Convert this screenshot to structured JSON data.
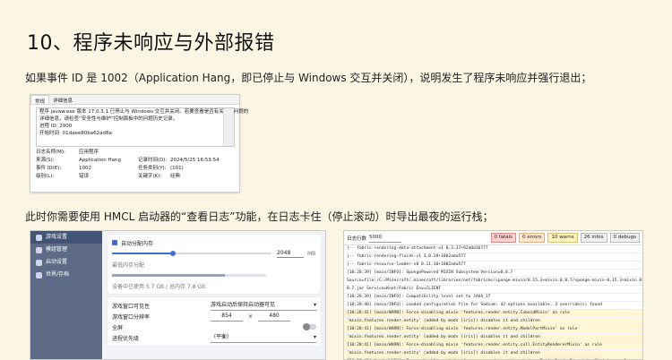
{
  "heading": "10、程序未响应与外部报错",
  "para1": "如果事件 ID 是 1002（Application Hang，即已停止与 Windows 交互并关闭），说明发生了程序未响应并强行退出；",
  "para2": "此时你需要使用 HMCL 启动器的“查看日志”功能，在日志卡住（停止滚动）时导出最夜的运行栈；",
  "event_viewer": {
    "tabs": [
      "常规",
      "详细信息"
    ],
    "description_lines": [
      "程序 javaw.exe 版本 17.0.3.1 已停止与 Windows 交互并关闭。若要查看是否有关于该问题的",
      "详细信息，请检查“安全性与维护”控制面板中的问题历史记录。",
      "进程 ID: 2900",
      "开始时间: 01daee80ba62ad8a"
    ],
    "rows": [
      [
        "日志名称(M):",
        "应用程序",
        "",
        ""
      ],
      [
        "来源(S):",
        "Application Hang",
        "记录时间(D):",
        "2024/5/25 16:53:54"
      ],
      [
        "事件 ID(E):",
        "1002",
        "任务类别(Y):",
        "(101)"
      ],
      [
        "级别(L):",
        "错误",
        "关键字(K):",
        "经典"
      ]
    ]
  },
  "hmcl": {
    "nav": [
      "游戏设置",
      "模组管理",
      "启动设置",
      "世界/存档"
    ],
    "auto_memory_label": "自动分配内存",
    "memory_usage_label": "最低内存分配",
    "memory_value": "2048",
    "memory_unit": "MB",
    "memory_fraction": 0.38,
    "usage_text": "设备中已使用 5.7 GB / 总内存 7.8 GB",
    "usage_fraction": 0.73,
    "rows": [
      {
        "label": "游戏窗口可见性",
        "value": "游戏启动后保持启动器可见"
      },
      {
        "label": "游戏窗口分辨率",
        "width": "854",
        "height": "480",
        "x": "×"
      },
      {
        "label": "全屏",
        "value": ""
      },
      {
        "label": "进程优先级",
        "value": "（平衡）"
      }
    ]
  },
  "log_viewer": {
    "level_label": "日志行数",
    "level_value": "5000",
    "badges": [
      "0 fatals",
      "0 errors",
      "10 warns",
      "26 infos",
      "0 debugs"
    ],
    "lines": [
      "  |-- fabric-rendering-data-attachment-v1 0.3.37+92a0d36777",
      "  |-- fabric-rendering-fluids-v1 3.0.28+1802ada577",
      "  |-- fabric-resource-loader-v0 0.11.10+1802ada577",
      "[10:28:39] [main/INFO]: SpongePowered MIXIN Subsystem Version=0.8.7",
      "Source=file:/C:/Minecraft/.minecraft/libraries/net/fabricmc/sponge-mixin/0.15.3+mixin.0.8.7/sponge-mixin-0.15.3+mixin.0.",
      "8.7.jar Service=Knot/Fabric Env=CLIENT",
      "[10:28:39] [main/INFO]: Compatibility level set to JAVA_17",
      "[10:28:40] [main/INFO]: Loaded configuration file for Sodium: 42 options available, 3 override(s) found",
      "[10:28:41] [main/WARN]: Force-disabling mixin 'features.render.entity.CuboidMixin' as rule",
      "'mixin.features.render.entity' (added by mods [iris]) disables it and children",
      "[10:28:41] [main/WARN]: Force-disabling mixin 'features.render.entity.ModelPartMixin' as rule",
      "'mixin.features.render.entity' (added by mods [iris]) disables it and children",
      "[10:28:41] [main/WARN]: Force-disabling mixin 'features.render.entity.cull.EntityRendererMixin' as rule",
      "'mixin.features.render.entity' (added by mods [iris]) disables it and children",
      "[10:28:41] [main/WARN]: Force-disabling mixin 'features.render.entity.shadows.EntityRenderDispatcherMixin' as rule"
    ],
    "warn_lines": [
      8,
      9,
      10,
      11,
      12,
      13,
      14
    ]
  }
}
